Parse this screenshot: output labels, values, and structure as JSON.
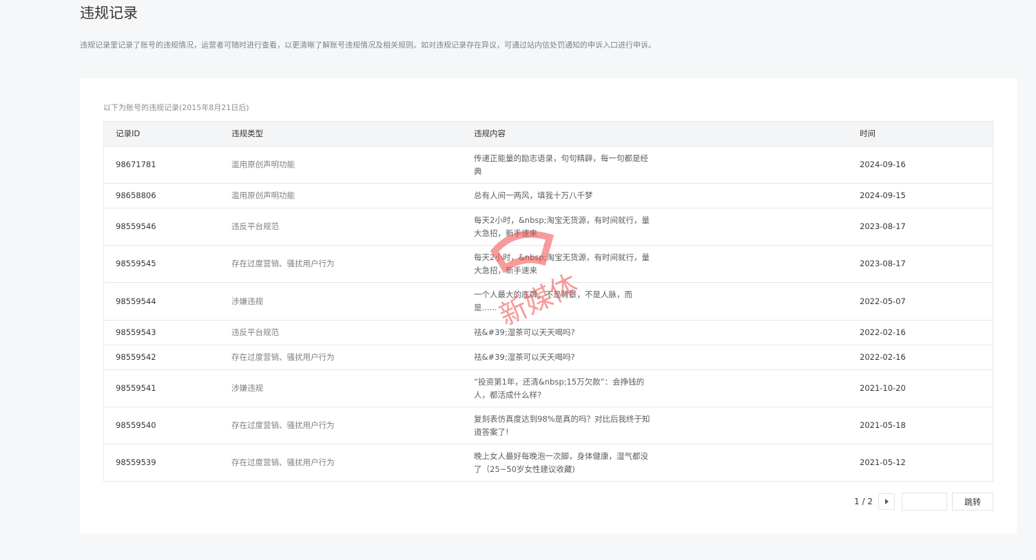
{
  "title": "违规记录",
  "description": "违规记录里记录了账号的违规情况，运营者可随时进行查看，以更清晰了解账号违规情况及相关规则。如对违规记录存在异议，可通过站内信处罚通知的申诉入口进行申诉。",
  "table": {
    "caption": "以下为账号的违规记录(2015年8月21日后)",
    "columns": [
      "记录ID",
      "违规类型",
      "违规内容",
      "时间"
    ],
    "rows": [
      {
        "id": "98671781",
        "type": "滥用原创声明功能",
        "content": "传递正能量的励志语录，句句精辟，每一句都是经典",
        "time": "2024-09-16"
      },
      {
        "id": "98658806",
        "type": "滥用原创声明功能",
        "content": "总有人间一两风，填我十万八千梦",
        "time": "2024-09-15"
      },
      {
        "id": "98559546",
        "type": "违反平台规范",
        "content": "每天2小时，&nbsp;淘宝无货源，有时间就行，量大急招，新手速来",
        "time": "2023-08-17"
      },
      {
        "id": "98559545",
        "type": "存在过度营销、骚扰用户行为",
        "content": "每天2小时，&nbsp;淘宝无货源，有时间就行，量大急招，新手速来",
        "time": "2023-08-17"
      },
      {
        "id": "98559544",
        "type": "涉嫌违规",
        "content": "一个人最大的底牌，不是背景，不是人脉，而是......",
        "time": "2022-05-07"
      },
      {
        "id": "98559543",
        "type": "违反平台规范",
        "content": "祛&#39;湿茶可以天天喝吗?",
        "time": "2022-02-16"
      },
      {
        "id": "98559542",
        "type": "存在过度营销、骚扰用户行为",
        "content": "祛&#39;湿茶可以天天喝吗?",
        "time": "2022-02-16"
      },
      {
        "id": "98559541",
        "type": "涉嫌违规",
        "content": "“投资第1年，还清&nbsp;15万欠款”：会挣钱的人，都活成什么样?",
        "time": "2021-10-20"
      },
      {
        "id": "98559540",
        "type": "存在过度营销、骚扰用户行为",
        "content": "复刻表仿真度达到98%是真的吗？对比后我终于知道答案了!",
        "time": "2021-05-18"
      },
      {
        "id": "98559539",
        "type": "存在过度营销、骚扰用户行为",
        "content": "晚上女人最好每晚泡一次脚，身体健康，湿气都没了（25~50岁女性建议收藏)",
        "time": "2021-05-12"
      }
    ]
  },
  "pagination": {
    "page_text": "1 / 2",
    "jump_label": "跳转",
    "jump_value": ""
  },
  "watermark": {
    "text": "新媒体",
    "color": "#f04a4a"
  }
}
